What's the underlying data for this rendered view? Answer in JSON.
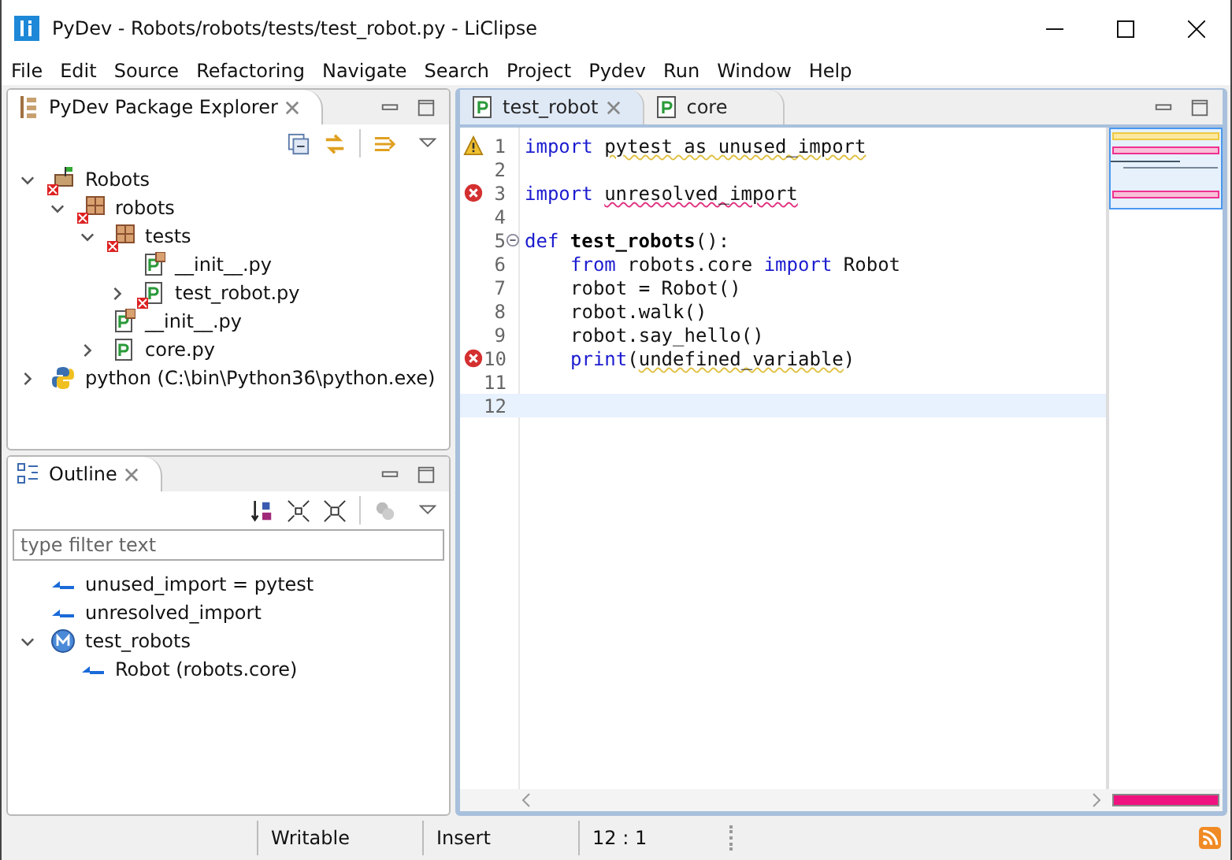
{
  "window": {
    "title": "PyDev - Robots/robots/tests/test_robot.py - LiClipse"
  },
  "menu": [
    "File",
    "Edit",
    "Source",
    "Refactoring",
    "Navigate",
    "Search",
    "Project",
    "Pydev",
    "Run",
    "Window",
    "Help"
  ],
  "explorer": {
    "title": "PyDev Package Explorer",
    "tree": [
      {
        "label": "Robots",
        "kind": "project",
        "error": true,
        "expanded": true,
        "children": [
          {
            "label": "robots",
            "kind": "package",
            "error": true,
            "expanded": true,
            "children": [
              {
                "label": "tests",
                "kind": "package",
                "error": true,
                "expanded": true,
                "children": [
                  {
                    "label": "__init__.py",
                    "kind": "init",
                    "error": false
                  },
                  {
                    "label": "test_robot.py",
                    "kind": "file",
                    "error": true,
                    "expanded": false
                  }
                ]
              },
              {
                "label": "__init__.py",
                "kind": "init",
                "error": false
              },
              {
                "label": "core.py",
                "kind": "file",
                "error": false,
                "expanded": false
              }
            ]
          }
        ]
      },
      {
        "label": "python  (C:\\bin\\Python36\\python.exe)",
        "kind": "interpreter",
        "error": false,
        "expanded": false
      }
    ]
  },
  "outline": {
    "title": "Outline",
    "filter": {
      "placeholder": "type filter text"
    },
    "tree": [
      {
        "label": "unused_import = pytest",
        "kind": "import"
      },
      {
        "label": "unresolved_import",
        "kind": "import"
      },
      {
        "label": "test_robots",
        "kind": "function",
        "expanded": true,
        "children": [
          {
            "label": "Robot (robots.core)",
            "kind": "import"
          }
        ]
      }
    ]
  },
  "editor": {
    "tabs": [
      {
        "label": "test_robot",
        "selected": true
      },
      {
        "label": "core",
        "selected": false
      }
    ],
    "lines": [
      {
        "number": "1",
        "kind": "warning",
        "current": false,
        "indented": false,
        "segments": [
          {
            "text": "import ",
            "kind": "kw"
          },
          {
            "text": "pytest as unused_import",
            "kind": "warning"
          }
        ]
      },
      {
        "number": "2",
        "kind": "plain",
        "current": false
      },
      {
        "number": "3",
        "kind": "error",
        "current": false,
        "indented": false,
        "segments": [
          {
            "text": "import ",
            "kind": "kw"
          },
          {
            "text": "unresolved_import",
            "kind": "error"
          }
        ]
      },
      {
        "number": "4",
        "kind": "plain",
        "current": false
      },
      {
        "number": "5",
        "kind": "fold",
        "current": false,
        "indented": false,
        "segments": [
          {
            "text": "def ",
            "kind": "kw"
          },
          {
            "text": "test_robots",
            "kind": "def"
          },
          {
            "text": "():",
            "kind": "plain"
          }
        ]
      },
      {
        "number": "6",
        "kind": "plain",
        "current": false,
        "indented": true,
        "segments": [
          {
            "text": "from",
            "kind": "kw"
          },
          {
            "text": " robots.core ",
            "kind": "plain"
          },
          {
            "text": "import",
            "kind": "kw"
          },
          {
            "text": " Robot",
            "kind": "plain"
          }
        ]
      },
      {
        "number": "7",
        "kind": "plain",
        "current": false,
        "indented": true,
        "segments": [
          {
            "text": "robot = Robot()",
            "kind": "plain"
          }
        ]
      },
      {
        "number": "8",
        "kind": "plain",
        "current": false,
        "indented": true,
        "segments": [
          {
            "text": "robot.walk()",
            "kind": "plain"
          }
        ]
      },
      {
        "number": "9",
        "kind": "plain",
        "current": false,
        "indented": true,
        "segments": [
          {
            "text": "robot.say_hello()",
            "kind": "plain"
          }
        ]
      },
      {
        "number": "10",
        "kind": "error",
        "current": false,
        "indented": true,
        "segments": [
          {
            "text": "print",
            "kind": "kw"
          },
          {
            "text": "(",
            "kind": "plain"
          },
          {
            "text": "undefined_variable",
            "kind": "warning"
          },
          {
            "text": ")",
            "kind": "plain"
          }
        ]
      },
      {
        "number": "11",
        "kind": "plain",
        "current": false
      },
      {
        "number": "12",
        "kind": "plain",
        "current": true
      }
    ]
  },
  "status_bar": [
    "Writable",
    "Insert",
    "12 : 1"
  ]
}
